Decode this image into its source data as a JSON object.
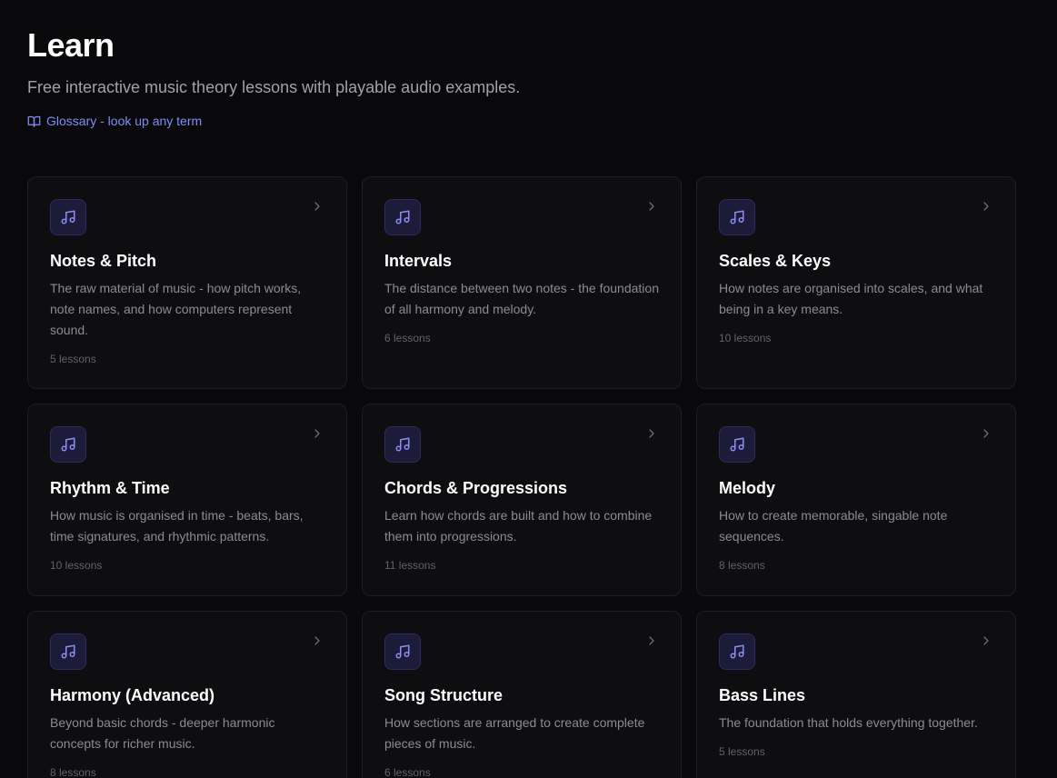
{
  "header": {
    "title": "Learn",
    "subtitle": "Free interactive music theory lessons with playable audio examples.",
    "glossary_link": "Glossary - look up any term",
    "glossary_icon": "book-open-icon"
  },
  "colors": {
    "background": "#09090b",
    "card_background": "#0e0e11",
    "card_border": "#1f1f23",
    "accent": "#818cf8",
    "icon_background": "#1c1b3a"
  },
  "topics": [
    {
      "title": "Notes & Pitch",
      "description": "The raw material of music - how pitch works, note names, and how computers represent sound.",
      "lessons": "5 lessons",
      "icon": "music-note-icon"
    },
    {
      "title": "Intervals",
      "description": "The distance between two notes - the foundation of all harmony and melody.",
      "lessons": "6 lessons",
      "icon": "music-note-icon"
    },
    {
      "title": "Scales & Keys",
      "description": "How notes are organised into scales, and what being in a key means.",
      "lessons": "10 lessons",
      "icon": "music-note-icon"
    },
    {
      "title": "Rhythm & Time",
      "description": "How music is organised in time - beats, bars, time signatures, and rhythmic patterns.",
      "lessons": "10 lessons",
      "icon": "music-note-icon"
    },
    {
      "title": "Chords & Progressions",
      "description": "Learn how chords are built and how to combine them into progressions.",
      "lessons": "11 lessons",
      "icon": "music-note-icon"
    },
    {
      "title": "Melody",
      "description": "How to create memorable, singable note sequences.",
      "lessons": "8 lessons",
      "icon": "music-note-icon"
    },
    {
      "title": "Harmony (Advanced)",
      "description": "Beyond basic chords - deeper harmonic concepts for richer music.",
      "lessons": "8 lessons",
      "icon": "music-note-icon"
    },
    {
      "title": "Song Structure",
      "description": "How sections are arranged to create complete pieces of music.",
      "lessons": "6 lessons",
      "icon": "music-note-icon"
    },
    {
      "title": "Bass Lines",
      "description": "The foundation that holds everything together.",
      "lessons": "5 lessons",
      "icon": "music-note-icon"
    }
  ]
}
